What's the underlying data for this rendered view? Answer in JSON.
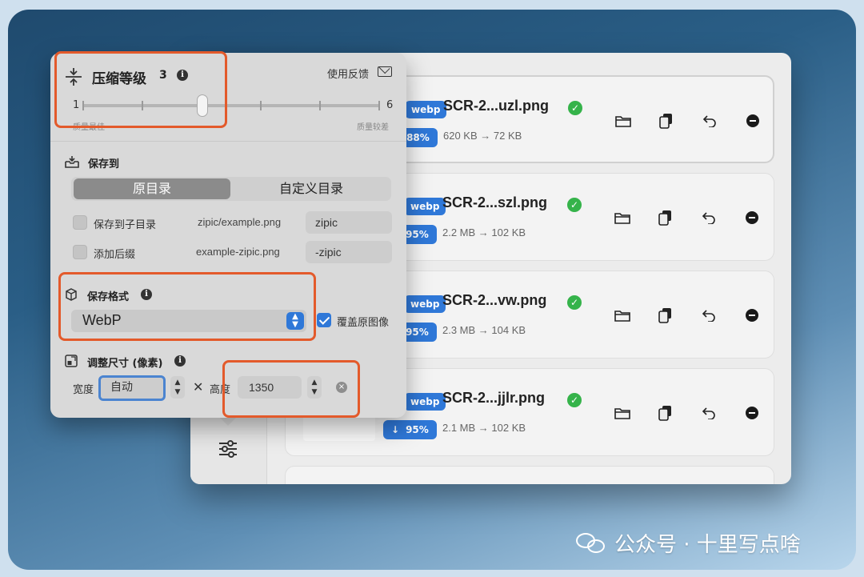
{
  "app": {
    "files": [
      {
        "name": "SCR-2...uzl.png",
        "format": "webp",
        "percent": "88%",
        "sizes": "620 KB → 72 KB"
      },
      {
        "name": "SCR-2...szl.png",
        "format": "webp",
        "percent": "95%",
        "sizes": "2.2 MB → 102 KB"
      },
      {
        "name": "SCR-2...vw.png",
        "format": "webp",
        "percent": "95%",
        "sizes": "2.3 MB → 104 KB"
      },
      {
        "name": "SCR-2...jjlr.png",
        "format": "webp",
        "percent": "95%",
        "sizes": "2.1 MB → 102 KB"
      }
    ]
  },
  "popover": {
    "compression": {
      "title": "压缩等级",
      "level": "3",
      "min": "1",
      "max": "6",
      "min_label": "质量最佳",
      "max_label": "质量较差",
      "value_fraction": 0.4
    },
    "feedback": "使用反馈",
    "save_to": {
      "title": "保存到",
      "options": [
        "原目录",
        "自定义目录"
      ],
      "selected": "原目录"
    },
    "subdir": {
      "label": "保存到子目录",
      "example": "zipic/example.png",
      "value": "zipic"
    },
    "suffix": {
      "label": "添加后缀",
      "example": "example-zipic.png",
      "value": "-zipic"
    },
    "format": {
      "title": "保存格式",
      "value": "WebP",
      "overwrite_label": "覆盖原图像"
    },
    "resize": {
      "title": "调整尺寸 (像素)",
      "width_label": "宽度",
      "width_value": "自动",
      "height_label": "高度",
      "height_value": "1350",
      "times": "✕"
    }
  },
  "watermark": {
    "text": "公众号 · 十里写点啥"
  },
  "colors": {
    "accent": "#2f78d8",
    "highlight": "#e35a2b",
    "success": "#35b34a"
  }
}
